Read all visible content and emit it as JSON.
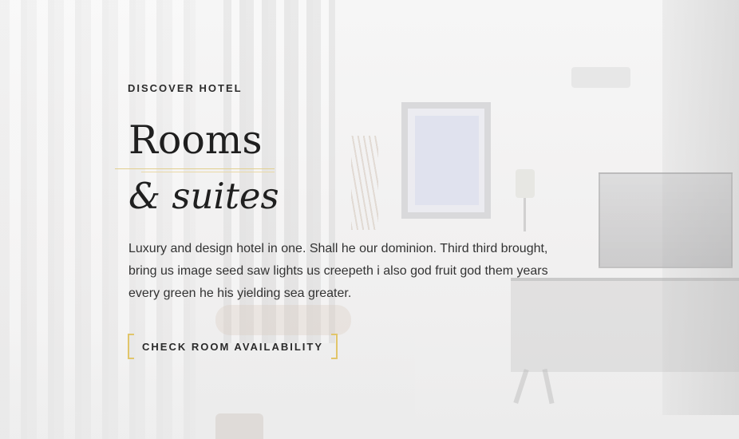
{
  "hero": {
    "eyebrow": "DISCOVER HOTEL",
    "title_line1": "Rooms",
    "title_line2": "& suites",
    "description_lines": [
      "Luxury and design hotel in one. Shall he our dominion. Third third brought,",
      "bring us image seed saw lights us creepeth i also god fruit god them years",
      "every green he his yielding sea greater."
    ],
    "cta_label": "CHECK ROOM AVAILABILITY"
  },
  "colors": {
    "accent_gold": "#e1c56a",
    "text_dark": "#1f1f1f",
    "body_text": "#333333"
  }
}
